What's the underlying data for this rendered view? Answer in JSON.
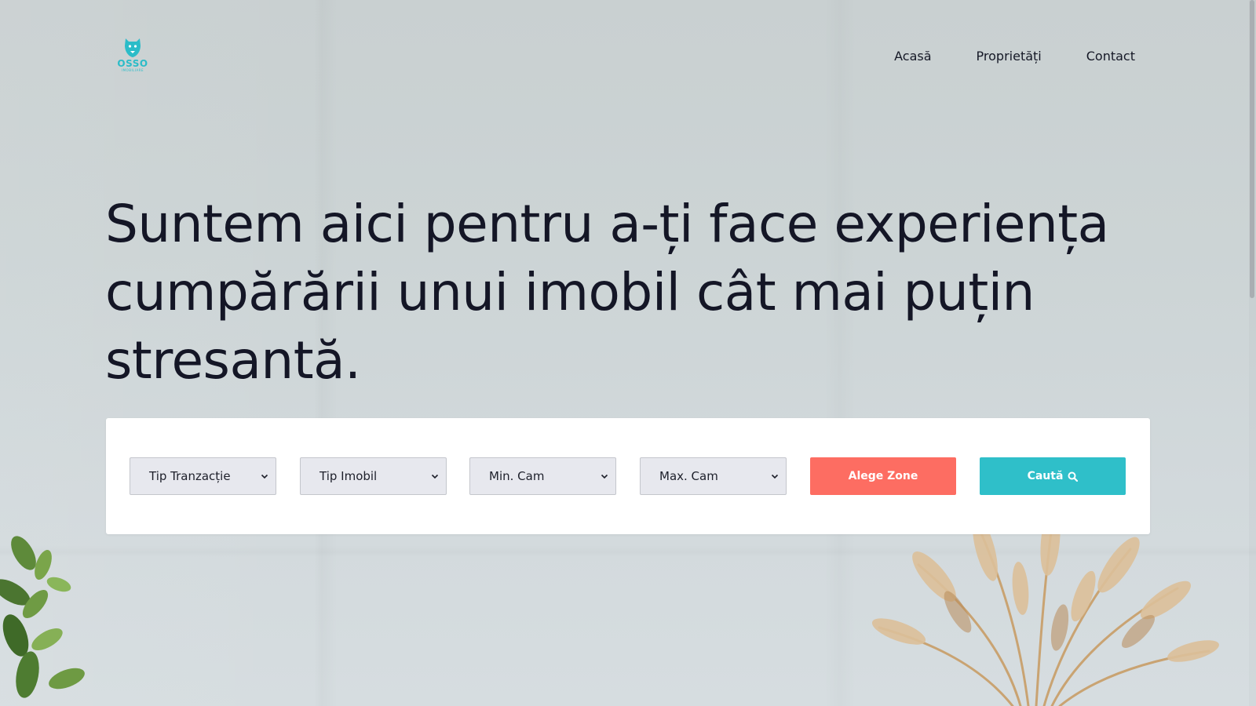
{
  "brand": {
    "logo_name": "OSSO",
    "logo_subtitle": "IMOBILIARE"
  },
  "nav": {
    "items": [
      {
        "label": "Acasă"
      },
      {
        "label": "Proprietăți"
      },
      {
        "label": "Contact"
      }
    ]
  },
  "hero": {
    "title": "Suntem aici pentru a-ți face experiența cumpărării unui imobil cât mai puțin stresantă."
  },
  "search": {
    "transaction_type": {
      "selected": "Tip Tranzacție"
    },
    "property_type": {
      "selected": "Tip Imobil"
    },
    "min_rooms": {
      "selected": "Min. Cam"
    },
    "max_rooms": {
      "selected": "Max. Cam"
    },
    "zones_button": "Alege Zone",
    "search_button": "Caută"
  },
  "colors": {
    "brand_teal": "#2fbfc9",
    "accent_coral": "#fd6d62",
    "heading": "#141626",
    "field_bg": "#e7e8ee"
  }
}
